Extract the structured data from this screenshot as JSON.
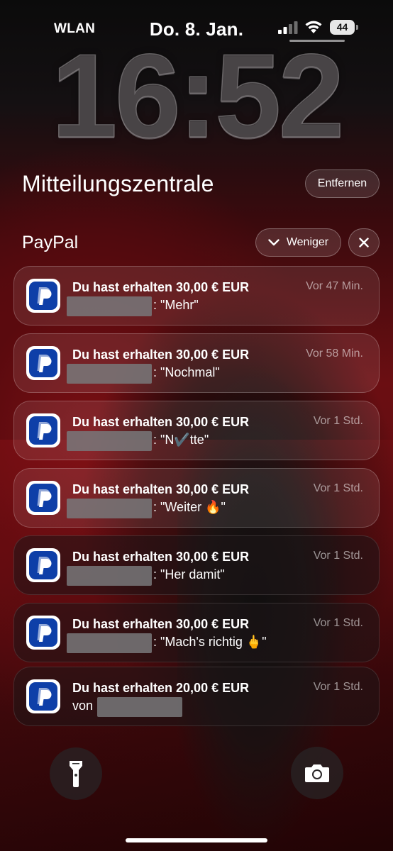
{
  "status_bar": {
    "carrier": "WLAN",
    "date": "Do. 8. Jan.",
    "battery": "44",
    "signal_icon": "cellular-signal-icon",
    "wifi_icon": "wifi-icon"
  },
  "lock_screen": {
    "time": "16:52"
  },
  "notification_center": {
    "title": "Mitteilungszentrale",
    "remove_label": "Entfernen"
  },
  "group": {
    "app_name": "PayPal",
    "less_label": "Weniger",
    "close_icon": "close-icon"
  },
  "notifications": [
    {
      "title": "Du hast erhalten 30,00 € EUR",
      "time": "Vor 47 Min.",
      "body": ": \"Mehr\""
    },
    {
      "title": "Du hast erhalten 30,00 € EUR",
      "time": "Vor 58 Min.",
      "body": ": \"Nochmal\""
    },
    {
      "title": "Du hast erhalten 30,00 € EUR",
      "time": "Vor 1 Std.",
      "body": ": \"N✔️tte\""
    },
    {
      "title": "Du hast erhalten 30,00 € EUR",
      "time": "Vor 1 Std.",
      "body": ": \"Weiter 🔥\""
    },
    {
      "title": "Du hast erhalten 30,00 € EUR",
      "time": "Vor 1 Std.",
      "body": ": \"Her damit\""
    },
    {
      "title": "Du hast erhalten 30,00 € EUR",
      "time": "Vor 1 Std.",
      "body": ": \"Mach's richtig 🖕\""
    },
    {
      "title": "Du hast erhalten 20,00 € EUR",
      "time": "Vor 1 Std.",
      "prefix": "von"
    }
  ],
  "bottom_controls": {
    "flashlight_icon": "flashlight-icon",
    "camera_icon": "camera-icon"
  }
}
